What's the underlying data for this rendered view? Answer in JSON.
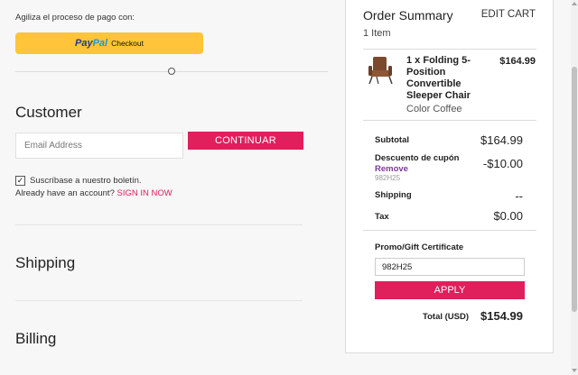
{
  "checkout": {
    "express_label": "Agiliza el proceso de pago con:",
    "paypal": {
      "logo_pay": "Pay",
      "logo_pal": "Pal",
      "label": "Checkout"
    },
    "customer": {
      "title": "Customer",
      "email_placeholder": "Email Address",
      "email_value": "",
      "continue_label": "CONTINUAR",
      "newsletter_checked": true,
      "newsletter_label": "Suscríbase a nuestro boletín.",
      "account_prompt": "Already have an account?",
      "signin_label": "SIGN IN NOW"
    },
    "shipping_title": "Shipping",
    "billing_title": "Billing"
  },
  "summary": {
    "title": "Order Summary",
    "edit_cart": "EDIT CART",
    "item_count": "1 Item",
    "product": {
      "name": "1 x Folding 5-Position Convertible Sleeper Chair",
      "price": "$164.99",
      "option": "Color Coffee",
      "image": "brown-sleeper-chair"
    },
    "subtotal_label": "Subtotal",
    "subtotal_value": "$164.99",
    "coupon_label": "Descuento de cupón",
    "coupon_remove": "Remove",
    "coupon_code": "982H25",
    "coupon_value": "-$10.00",
    "shipping_label": "Shipping",
    "shipping_value": "--",
    "tax_label": "Tax",
    "tax_value": "$0.00",
    "promo_label": "Promo/Gift Certificate",
    "promo_value": "982H25",
    "apply_label": "APPLY",
    "total_label": "Total (USD)",
    "total_value": "$154.99"
  },
  "colors": {
    "accent": "#e01f5d",
    "paypal_yellow": "#ffc439",
    "paypal_blue_dark": "#253b80",
    "paypal_blue_light": "#179bd7",
    "remove_link": "#7a3a9a"
  }
}
